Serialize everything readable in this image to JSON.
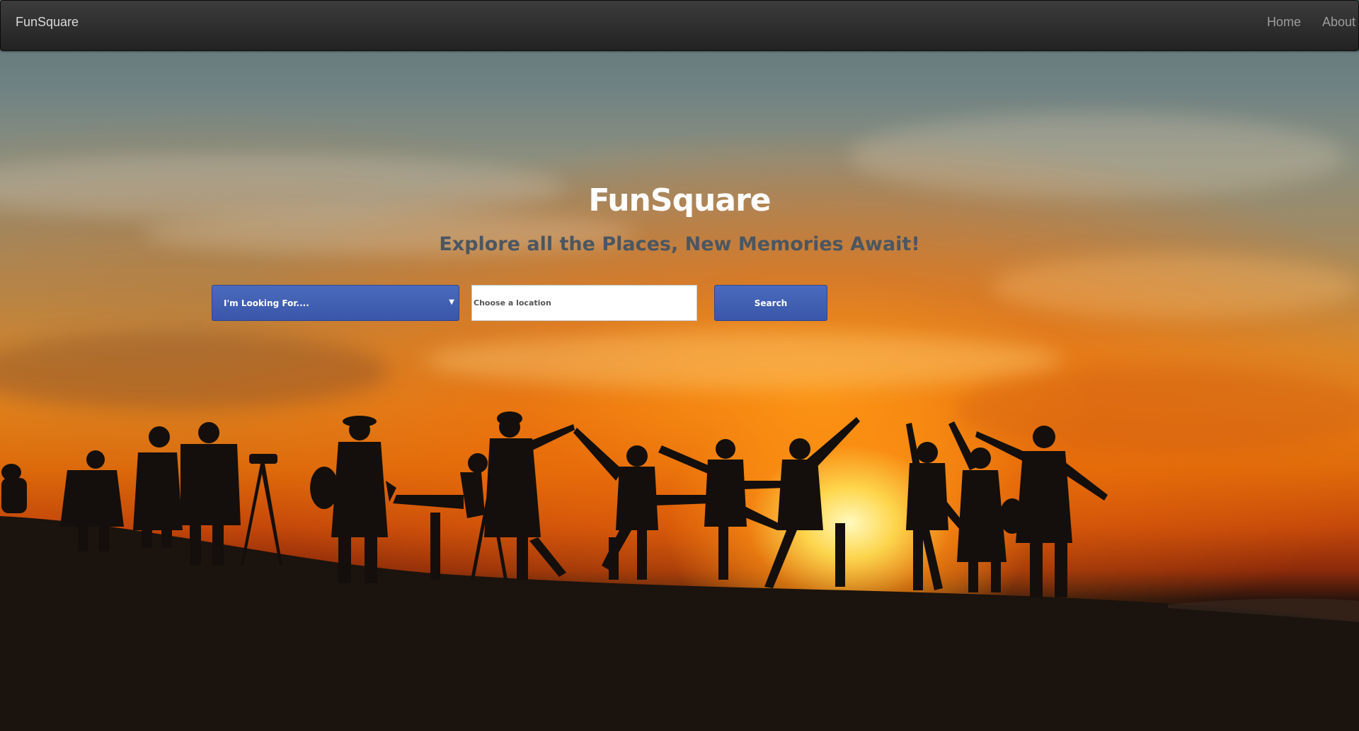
{
  "navbar": {
    "brand": "FunSquare",
    "links": [
      {
        "label": "Home"
      },
      {
        "label": "About"
      }
    ]
  },
  "hero": {
    "title": "FunSquare",
    "subtitle": "Explore all the Places, New Memories Await!",
    "search": {
      "category_selected": "I'm Looking For....",
      "location_placeholder": "Choose a location",
      "location_value": "",
      "button_label": "Search"
    }
  },
  "colors": {
    "navbar_bg": "#2a2a2a",
    "button_blue": "#3f5eb2",
    "subtitle_text": "#4b5661"
  },
  "icons": {
    "select_caret": "caret-down-icon"
  }
}
